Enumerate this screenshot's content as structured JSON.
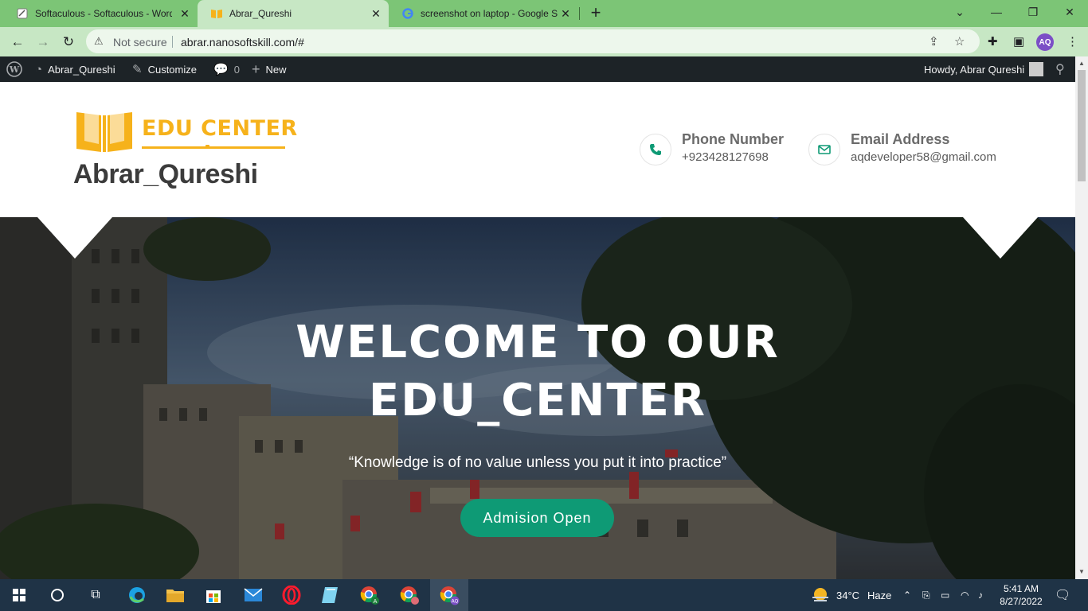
{
  "browser": {
    "tabs": [
      {
        "title": "Softaculous - Softaculous - Word",
        "favicon": "softaculous-icon"
      },
      {
        "title": "Abrar_Qureshi",
        "favicon": "book-icon"
      },
      {
        "title": "screenshot on laptop - Google Se",
        "favicon": "google-icon"
      }
    ],
    "close_symbol": "✕",
    "new_tab_symbol": "+",
    "security_label": "Not secure",
    "url": "abrar.nanosoftskill.com/#",
    "profile_initials": "AQ"
  },
  "wp_admin_bar": {
    "site_name": "Abrar_Qureshi",
    "customize": "Customize",
    "comments_count": "0",
    "new": "New",
    "howdy": "Howdy, Abrar Qureshi"
  },
  "site": {
    "logo_text": "EDU CENTER",
    "title": "Abrar_Qureshi",
    "phone_label": "Phone Number",
    "phone_value": "+923428127698",
    "email_label": "Email Address",
    "email_value": "aqdeveloper58@gmail.com",
    "brand_color": "#f6b21b",
    "accent_color": "#0e9a75"
  },
  "hero": {
    "heading_line1": "WELCOME TO OUR",
    "heading_line2": "EDU_CENTER",
    "quote": "“Knowledge is of no value unless you put it into practice”",
    "button": "Admision Open"
  },
  "taskbar": {
    "weather_temp": "34°C",
    "weather_desc": "Haze",
    "time": "5:41 AM",
    "date": "8/27/2022"
  }
}
